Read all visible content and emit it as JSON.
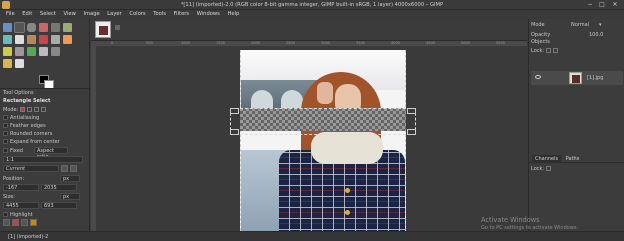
{
  "window": {
    "title": "*[11] (imported)-2.0 (RGB color 8-bit gamma integer, GIMP built-in sRGB, 1 layer) 4000x6000 – GIMP",
    "controls": [
      "−",
      "□",
      "✕"
    ]
  },
  "menu": [
    "File",
    "Edit",
    "Select",
    "View",
    "Image",
    "Layer",
    "Colors",
    "Tools",
    "Filters",
    "Windows",
    "Help"
  ],
  "tool_options": {
    "tab_label": "Tool Options",
    "title": "Rectangle Select",
    "mode_label": "Mode:",
    "antialiasing": "Antialiasing",
    "feather_edges": "Feather edges",
    "rounded_corners": "Rounded corners",
    "expand_from_center": "Expand from center",
    "fixed_label": "Fixed",
    "fixed_value": "Aspect ratio",
    "ratio_value": "1:1",
    "current": "Current",
    "position_label": "Position:",
    "position_unit": "px",
    "position_x": "-167",
    "position_y": "2035",
    "size_label": "Size:",
    "size_unit": "px",
    "size_w": "4455",
    "size_h": "693",
    "highlight": "Highlight"
  },
  "ruler": [
    "0",
    "500",
    "1000",
    "1500",
    "2000",
    "2500",
    "3000",
    "3500",
    "4000",
    "4500",
    "5000",
    "5500"
  ],
  "right_panel": {
    "objects_label": "Objects",
    "mode_label": "Mode",
    "mode_value": "Normal",
    "opacity_label": "Opacity",
    "opacity_value": "100.0",
    "lock_label": "Lock:",
    "layer_name": "[1].jpg",
    "tabs": [
      "Channels",
      "Paths"
    ],
    "lower_lock": "Lock:"
  },
  "status": {
    "text": "[1] (imported)-2"
  },
  "watermark": {
    "line1": "Activate Windows",
    "line2": "Go to PC settings to activate Windows."
  }
}
